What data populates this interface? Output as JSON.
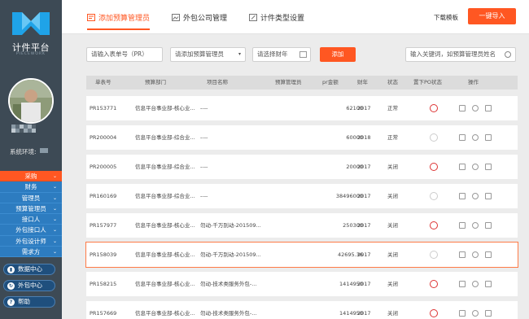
{
  "sidebar": {
    "logo_title": "计件平台",
    "logo_sub": "PIECEWORK",
    "env_label": "系统环境:",
    "menu": [
      {
        "label": "采购",
        "active": true
      },
      {
        "label": "财务"
      },
      {
        "label": "管理员"
      },
      {
        "label": "预算管理员"
      },
      {
        "label": "接口人"
      },
      {
        "label": "外包接口人"
      },
      {
        "label": "外包设计师"
      },
      {
        "label": "需求方"
      }
    ],
    "pills": [
      {
        "icon": "chart-icon",
        "label": "数据中心"
      },
      {
        "icon": "refresh-icon",
        "label": "外包中心"
      },
      {
        "icon": "help-icon",
        "label": "帮助"
      }
    ]
  },
  "topbar": {
    "tabs": [
      {
        "label": "添加预算管理员",
        "active": true
      },
      {
        "label": "外包公司管理"
      },
      {
        "label": "计件类型设置"
      }
    ],
    "download_label": "下载模板",
    "import_label": "一键导入"
  },
  "filters": {
    "pr_placeholder": "请输入表单号（PR）",
    "manager_placeholder": "请添加预算管理员",
    "year_placeholder": "请选择财年",
    "add_label": "添加",
    "search_placeholder": "输入关键词，如预算管理员姓名"
  },
  "table": {
    "headers": [
      "单表号",
      "预算部门",
      "项目名称",
      "预算管理员",
      "pr金额",
      "财年",
      "状态",
      "置下PO状态",
      "操作"
    ],
    "rows": [
      {
        "pr": "PR153771",
        "dept": "信息平台事业部-核心业...",
        "project": "----",
        "amount": "62100",
        "year": "2017",
        "status": "正常",
        "seal": true
      },
      {
        "pr": "PR200004",
        "dept": "信息平台事业部-综合业...",
        "project": "----",
        "amount": "60000",
        "year": "2018",
        "status": "正常",
        "seal": false
      },
      {
        "pr": "PR200005",
        "dept": "信息平台事业部-综合业...",
        "project": "----",
        "amount": "20000",
        "year": "2017",
        "status": "关闭",
        "seal": true
      },
      {
        "pr": "PR160169",
        "dept": "信息平台事业部-综合业...",
        "project": "----",
        "amount": "38496000",
        "year": "2017",
        "status": "关闭",
        "seal": false
      },
      {
        "pr": "PR157977",
        "dept": "信息平台事业部-核心业...",
        "project": "勿动-千万别动-201509...",
        "amount": "250300",
        "year": "2017",
        "status": "关闭",
        "seal": true
      },
      {
        "pr": "PR158039",
        "dept": "信息平台事业部-核心业...",
        "project": "勿动-千万别动-201509...",
        "amount": "42695.36",
        "year": "2017",
        "status": "关闭",
        "seal": false,
        "selected": true
      },
      {
        "pr": "PR158215",
        "dept": "信息平台事业部-核心业...",
        "project": "勿动-技术类服务外包-...",
        "amount": "1414950",
        "year": "2017",
        "status": "关闭",
        "seal": true
      },
      {
        "pr": "PR157669",
        "dept": "信息平台事业部-核心业...",
        "project": "勿动-技术类服务外包-...",
        "amount": "1414950",
        "year": "2017",
        "status": "关闭",
        "seal": true
      }
    ]
  },
  "colors": {
    "accent": "#ff5722",
    "sidebar_bg": "#3d4a55",
    "menu_blue": "#2d7cc0"
  }
}
